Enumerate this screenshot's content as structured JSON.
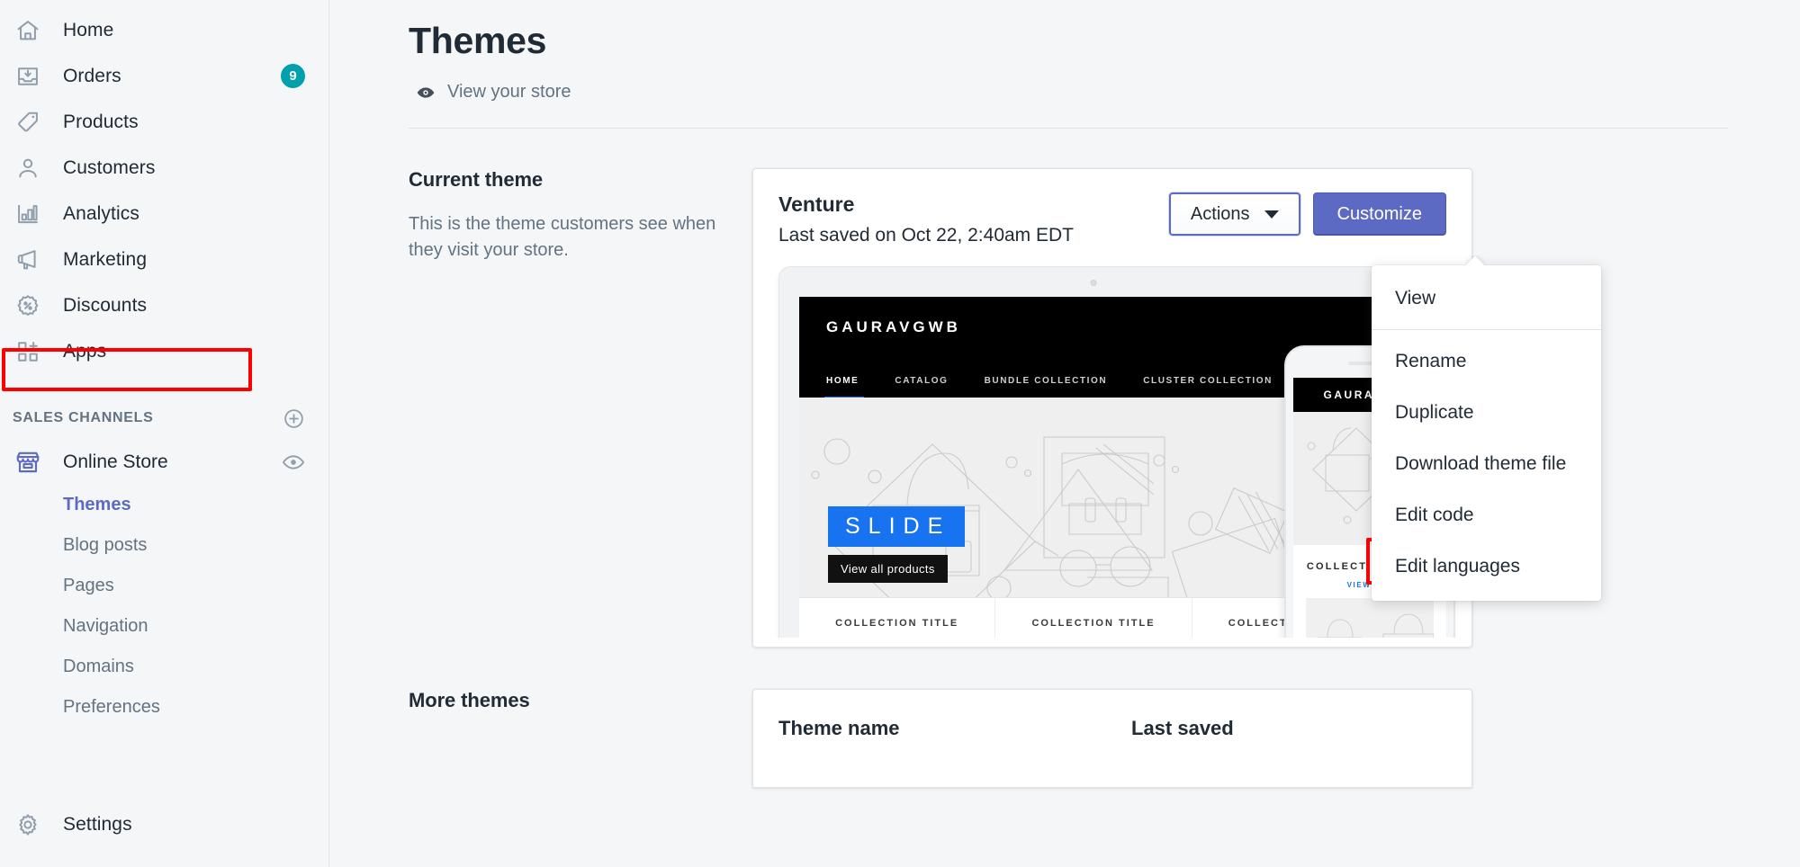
{
  "sidebar": {
    "nav": [
      {
        "label": "Home",
        "icon": "home-icon",
        "badge": ""
      },
      {
        "label": "Orders",
        "icon": "orders-icon",
        "badge": "9"
      },
      {
        "label": "Products",
        "icon": "products-tag-icon",
        "badge": ""
      },
      {
        "label": "Customers",
        "icon": "customers-person-icon",
        "badge": ""
      },
      {
        "label": "Analytics",
        "icon": "analytics-bars-icon",
        "badge": ""
      },
      {
        "label": "Marketing",
        "icon": "marketing-megaphone-icon",
        "badge": ""
      },
      {
        "label": "Discounts",
        "icon": "discounts-percent-icon",
        "badge": ""
      },
      {
        "label": "Apps",
        "icon": "apps-grid-plus-icon",
        "badge": ""
      }
    ],
    "sales_channels_title": "SALES CHANNELS",
    "add_channel_icon": "plus-circle-icon",
    "online_store": {
      "label": "Online Store",
      "icon": "storefront-icon",
      "view_icon": "eye-icon",
      "highlighted": true
    },
    "subnav": [
      {
        "label": "Themes",
        "active": true
      },
      {
        "label": "Blog posts",
        "active": false
      },
      {
        "label": "Pages",
        "active": false
      },
      {
        "label": "Navigation",
        "active": false
      },
      {
        "label": "Domains",
        "active": false
      },
      {
        "label": "Preferences",
        "active": false
      }
    ],
    "settings": {
      "label": "Settings",
      "icon": "gear-icon"
    }
  },
  "header": {
    "title": "Themes",
    "view_store_label": "View your store",
    "view_store_icon": "eye-icon"
  },
  "current_theme": {
    "heading": "Current theme",
    "description": "This is the theme customers see when they visit your store.",
    "theme_name": "Venture",
    "last_saved": "Last saved on Oct 22, 2:40am EDT",
    "actions_button": "Actions",
    "actions_caret_icon": "chevron-down-icon",
    "customize_button": "Customize"
  },
  "actions_menu": {
    "items": [
      {
        "label": "View",
        "highlighted": false,
        "separator_after": true
      },
      {
        "label": "Rename",
        "highlighted": false,
        "separator_after": false
      },
      {
        "label": "Duplicate",
        "highlighted": false,
        "separator_after": false
      },
      {
        "label": "Download theme file",
        "highlighted": false,
        "separator_after": false
      },
      {
        "label": "Edit code",
        "highlighted": true,
        "separator_after": false
      },
      {
        "label": "Edit languages",
        "highlighted": false,
        "separator_after": false
      }
    ]
  },
  "preview": {
    "store_logo": "GAURAVGWB",
    "store_nav": [
      "HOME",
      "CATALOG",
      "BUNDLE COLLECTION",
      "CLUSTER COLLECTION"
    ],
    "slide_label": "SLIDE",
    "slide_cta": "View all products",
    "collection_titles": [
      "COLLECTION TITLE",
      "COLLECTION TITLE",
      "COLLECTION TITLE"
    ],
    "mobile": {
      "logo": "GAURAVGWB",
      "cart_icon": "cart-icon",
      "collection_title": "COLLECTION TITLE",
      "view_all": "VIEW ALL"
    }
  },
  "more_themes": {
    "heading": "More themes",
    "columns": [
      "Theme name",
      "Last saved"
    ]
  },
  "colors": {
    "accent": "#5c6ac4",
    "badge": "#00a0ac",
    "highlight": "#ff0000",
    "page_bg": "#f4f6f8",
    "text": "#212b36",
    "muted": "#637381",
    "slide_blue": "#1773f0"
  }
}
